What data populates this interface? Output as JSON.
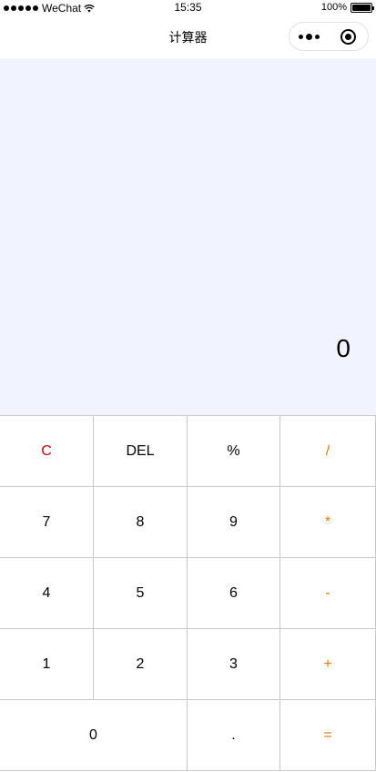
{
  "status_bar": {
    "carrier": "WeChat",
    "time": "15:35",
    "battery": "100%"
  },
  "nav": {
    "title": "计算器"
  },
  "display": {
    "value": "0"
  },
  "keys": {
    "clear": "C",
    "delete": "DEL",
    "percent": "%",
    "divide": "/",
    "seven": "7",
    "eight": "8",
    "nine": "9",
    "multiply": "*",
    "four": "4",
    "five": "5",
    "six": "6",
    "minus": "-",
    "one": "1",
    "two": "2",
    "three": "3",
    "plus": "+",
    "zero": "0",
    "dot": ".",
    "equals": "="
  },
  "colors": {
    "display_bg": "#f1f4fe",
    "clear_key": "#d60000",
    "operator_key": "#e47a00",
    "grid_line": "#c8c8c8"
  }
}
